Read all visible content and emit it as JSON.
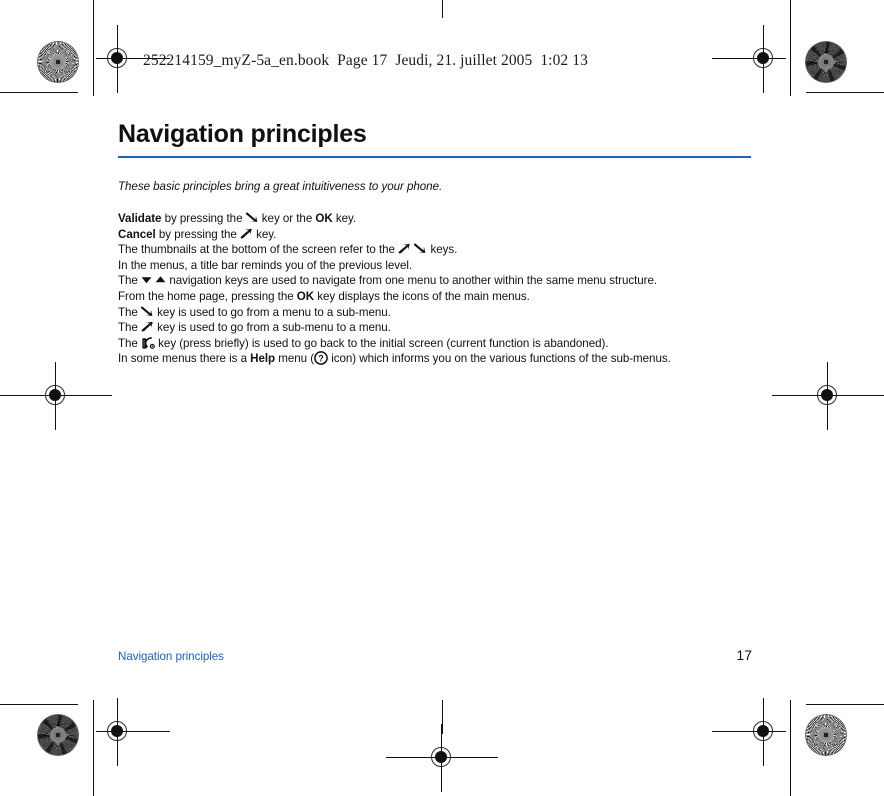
{
  "book_header": "252214159_myZ-5a_en.book  Page 17  Jeudi, 21. juillet 2005  1:02 13",
  "page": {
    "title": "Navigation principles",
    "lede": "These basic principles bring a great intuitiveness to your phone.",
    "accent_color": "#1a63c4",
    "lines": [
      {
        "id": "validate",
        "parts": [
          {
            "type": "bold",
            "text": "Validate"
          },
          {
            "type": "text",
            "text": " by pressing the "
          },
          {
            "type": "icon",
            "name": "arrow-down-right-key-icon"
          },
          {
            "type": "text",
            "text": " key or the "
          },
          {
            "type": "bold",
            "text": "OK"
          },
          {
            "type": "text",
            "text": " key."
          }
        ]
      },
      {
        "id": "cancel",
        "parts": [
          {
            "type": "bold",
            "text": "Cancel"
          },
          {
            "type": "text",
            "text": " by pressing the "
          },
          {
            "type": "icon",
            "name": "arrow-up-right-key-icon"
          },
          {
            "type": "text",
            "text": " key."
          }
        ]
      },
      {
        "id": "thumbnails",
        "parts": [
          {
            "type": "text",
            "text": "The thumbnails at the bottom of the screen refer to the "
          },
          {
            "type": "icon",
            "name": "arrow-up-right-key-icon"
          },
          {
            "type": "text",
            "text": " "
          },
          {
            "type": "icon",
            "name": "arrow-down-right-key-icon"
          },
          {
            "type": "text",
            "text": " keys."
          }
        ]
      },
      {
        "id": "title-bar",
        "parts": [
          {
            "type": "text",
            "text": "In the menus, a title bar reminds you of the previous level."
          }
        ]
      },
      {
        "id": "navigation-keys",
        "parts": [
          {
            "type": "text",
            "text": "The "
          },
          {
            "type": "icon",
            "name": "triangle-down-icon"
          },
          {
            "type": "text",
            "text": " "
          },
          {
            "type": "icon",
            "name": "triangle-up-icon"
          },
          {
            "type": "text",
            "text": " navigation keys are used to navigate from one menu to another within the same menu structure."
          }
        ]
      },
      {
        "id": "home-page",
        "parts": [
          {
            "type": "text",
            "text": "From the home page, pressing the "
          },
          {
            "type": "bold",
            "text": "OK"
          },
          {
            "type": "text",
            "text": " key displays the icons of the main menus."
          }
        ]
      },
      {
        "id": "menu-to-submenu",
        "parts": [
          {
            "type": "text",
            "text": "The "
          },
          {
            "type": "icon",
            "name": "arrow-down-right-key-icon"
          },
          {
            "type": "text",
            "text": " key  is used to go from a menu to a sub-menu."
          }
        ]
      },
      {
        "id": "submenu-to-menu",
        "parts": [
          {
            "type": "text",
            "text": "The "
          },
          {
            "type": "icon",
            "name": "arrow-up-right-key-icon"
          },
          {
            "type": "text",
            "text": " key is used to go from a sub-menu to a menu."
          }
        ]
      },
      {
        "id": "hangup-key",
        "parts": [
          {
            "type": "text",
            "text": "The "
          },
          {
            "type": "icon",
            "name": "hangup-phone-key-icon"
          },
          {
            "type": "text",
            "text": " key (press briefly) is used to go back to the initial screen (current function is abandoned)."
          }
        ]
      },
      {
        "id": "help-menu",
        "parts": [
          {
            "type": "text",
            "text": "In some menus there is a "
          },
          {
            "type": "bold",
            "text": "Help"
          },
          {
            "type": "text",
            "text": " menu ("
          },
          {
            "type": "icon",
            "name": "help-question-icon"
          },
          {
            "type": "text",
            "text": " icon) which informs you on the various functions of the sub-menus."
          }
        ]
      }
    ]
  },
  "footer": {
    "chapter": "Navigation principles",
    "page_number": "17"
  }
}
